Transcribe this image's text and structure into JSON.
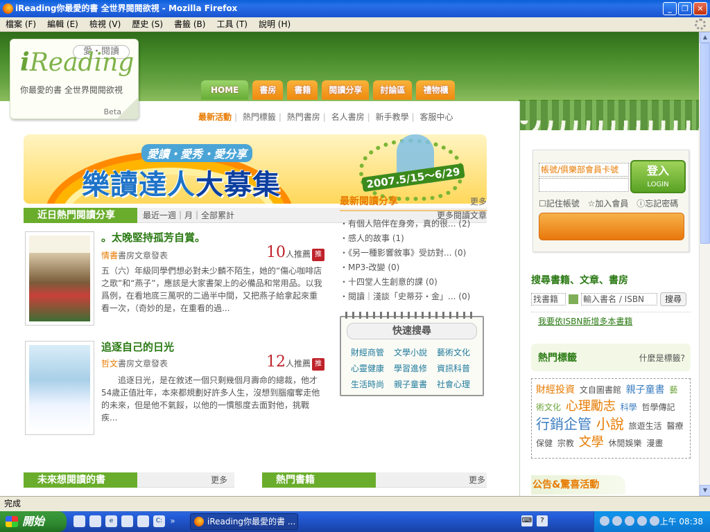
{
  "window": {
    "title": "iReading你最愛的書 全世界閱閱欲視 - Mozilla Firefox",
    "min": "_",
    "max": "❐",
    "close": "✕"
  },
  "menu": [
    "檔案 (F)",
    "編輯 (E)",
    "檢視 (V)",
    "歷史 (S)",
    "書籤 (B)",
    "工具 (T)",
    "說明 (H)"
  ],
  "logo": {
    "badge": "愛・閱讀",
    "brand_i": "i",
    "brand_rest": "Reading",
    "tagline": "你最愛的書 全世界閱閱欲視",
    "beta": "Beta"
  },
  "nav": [
    "HOME",
    "書房",
    "書籍",
    "閱讀分享",
    "討論區",
    "禮物櫃"
  ],
  "subnav": [
    "最新活動",
    "熱門標籤",
    "熱門書房",
    "名人書房",
    "新手教學",
    "客服中心"
  ],
  "banner": {
    "sub": "愛讀・愛秀・愛分享",
    "main_a": "樂讀達人",
    "main_b": "大募集",
    "date": "2007.5/15～6/29"
  },
  "recent": {
    "title": "近日熱門閱讀分享",
    "filters": "最近一週｜月｜全部累計",
    "more": "更多閱讀文章",
    "items": [
      {
        "title": "。太晚堅持孤芳自賞。",
        "owner": "情書",
        "owner_suffix": "書房文章發表",
        "count": "10",
        "count_suffix": "人推薦",
        "badge": "推",
        "desc": "五（六）年級同學們想必對未少麟不陌生，她的“傷心咖啡店之歌”和“燕子”，應該是大家書架上的必備品和常用品。以我爲例，在看地底三萬呎的二過半中間，又把燕子給拿起來重看一次，（奇妙的是，在重看的過..."
      },
      {
        "title": "追逐自己的日光",
        "owner": "哲文",
        "owner_suffix": "書房文章發表",
        "count": "12",
        "count_suffix": "人推薦",
        "badge": "推",
        "desc": "追逐日光，是在敘述一個只剩幾個月壽命的總裁，他才54歲正值壯年，本來都規劃好許多人生，沒想到腦瘤奪走他的未來，但是他不氣餒，以他的一慣態度去面對他，挑戰疾..."
      }
    ]
  },
  "share": {
    "title": "最新閱讀分享",
    "more": "更多",
    "items": [
      "・有個人陪伴在身旁，真的很... (2)",
      "・感人的故事 (1)",
      "・《另一種影響敘事》受訪對... (0)",
      "・MP3-改變 (0)",
      "・十四堂人生創意的課 (0)",
      "・閱讀｜淺談「史蒂芬・金」... (0)"
    ]
  },
  "quicksearch": {
    "title": "快速搜尋",
    "items": [
      "財經商管",
      "文學小說",
      "藝術文化",
      "心靈健康",
      "學習進修",
      "資訊科普",
      "生活時尚",
      "親子童書",
      "社會心理"
    ]
  },
  "login": {
    "account": "帳號/俱樂部會員卡號",
    "password": "",
    "button": "登入",
    "button_en": "LOGIN",
    "remember": "記住帳號",
    "join": "加入會員",
    "forgot": "忘記密碼"
  },
  "search": {
    "title": "搜尋書籍、文章、書房",
    "type": "找書籍",
    "placeholder": "輸入書名 / ISBN",
    "button": "搜尋",
    "link": "我要依ISBN新增多本書籍"
  },
  "tags": {
    "title": "熱門標籤",
    "help": "什麼是標籤?",
    "cloud": [
      {
        "t": "財經投資",
        "c": "t-o t-m"
      },
      {
        "t": "文自圖書館",
        "c": ""
      },
      {
        "t": "親子童書",
        "c": "t-b t-m"
      },
      {
        "t": "藝術文化",
        "c": "t-g"
      },
      {
        "t": "心理勵志",
        "c": "t-o t-l"
      },
      {
        "t": "科學",
        "c": "t-b"
      },
      {
        "t": "哲學傳記",
        "c": ""
      },
      {
        "t": "行銷企管",
        "c": "t-b t-x"
      },
      {
        "t": "小說",
        "c": "t-o t-x"
      },
      {
        "t": "旅遊生活",
        "c": ""
      },
      {
        "t": "醫療保健",
        "c": ""
      },
      {
        "t": "宗教",
        "c": ""
      },
      {
        "t": "文學",
        "c": "t-o t-l"
      },
      {
        "t": "休閒娛樂",
        "c": ""
      },
      {
        "t": "漫畫",
        "c": ""
      }
    ]
  },
  "bottom": {
    "future": "未來想閱讀的書",
    "future_more": "更多",
    "hot": "熱門書籍",
    "hot_more": "更多",
    "notice": "公告&驚喜活動"
  },
  "status": "完成",
  "taskbar": {
    "start": "開始",
    "item": "iReading你最愛的書 ...",
    "clock": "上午 08:38"
  }
}
